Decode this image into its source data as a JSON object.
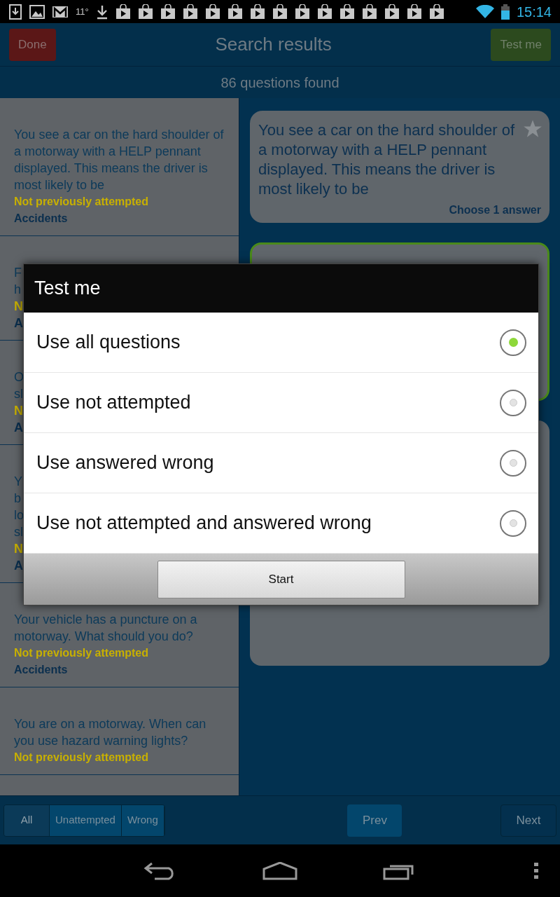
{
  "status_bar": {
    "temperature": "11°",
    "time": "15:14"
  },
  "header": {
    "done": "Done",
    "title": "Search results",
    "test_me": "Test me",
    "count": "86 questions found"
  },
  "list": [
    {
      "kind": "full",
      "question": "You see a car on the hard shoulder of a motorway with a HELP pennant displayed. This means the driver is most likely to be",
      "status": "Not previously attempted",
      "category": "Accidents"
    },
    {
      "kind": "partial",
      "fragments": [
        {
          "kind": "question",
          "text": "F"
        },
        {
          "kind": "question",
          "text": "h"
        },
        {
          "kind": "status",
          "text": "N"
        },
        {
          "kind": "category",
          "text": "A"
        }
      ]
    },
    {
      "kind": "partial",
      "fragments": [
        {
          "kind": "question",
          "text": "O"
        },
        {
          "kind": "question",
          "text": "sl"
        },
        {
          "kind": "status",
          "text": "N"
        },
        {
          "kind": "category",
          "text": "A"
        }
      ]
    },
    {
      "kind": "partial",
      "fragments": [
        {
          "kind": "question",
          "text": "Y"
        },
        {
          "kind": "question",
          "text": "b"
        },
        {
          "kind": "question",
          "text": "lo"
        },
        {
          "kind": "question",
          "text": "sl"
        },
        {
          "kind": "status",
          "text": "N"
        },
        {
          "kind": "category",
          "text": "A"
        }
      ]
    },
    {
      "kind": "full",
      "question": "Your vehicle has a puncture on a motorway. What should you do?",
      "status": "Not previously attempted",
      "category": "Accidents"
    },
    {
      "kind": "full",
      "question": "You are on a motorway. When can you use hazard warning lights?",
      "status": "Not previously attempted"
    }
  ],
  "question_card": {
    "text": "You see a car on the hard shoulder of a motorway with a HELP pennant displayed. This means the driver is most likely to be",
    "hint": "Choose 1 answer"
  },
  "dialog": {
    "title": "Test me",
    "options": [
      {
        "label": "Use all questions",
        "selected": true
      },
      {
        "label": "Use not attempted",
        "selected": false
      },
      {
        "label": "Use answered wrong",
        "selected": false
      },
      {
        "label": "Use not attempted and answered wrong",
        "selected": false
      }
    ],
    "button": "Start"
  },
  "bottom_bar": {
    "filters": [
      {
        "label": "All",
        "selected": true
      },
      {
        "label": "Unattempted",
        "selected": false
      },
      {
        "label": "Wrong",
        "selected": false
      }
    ],
    "prev": "Prev",
    "next": "Next"
  }
}
